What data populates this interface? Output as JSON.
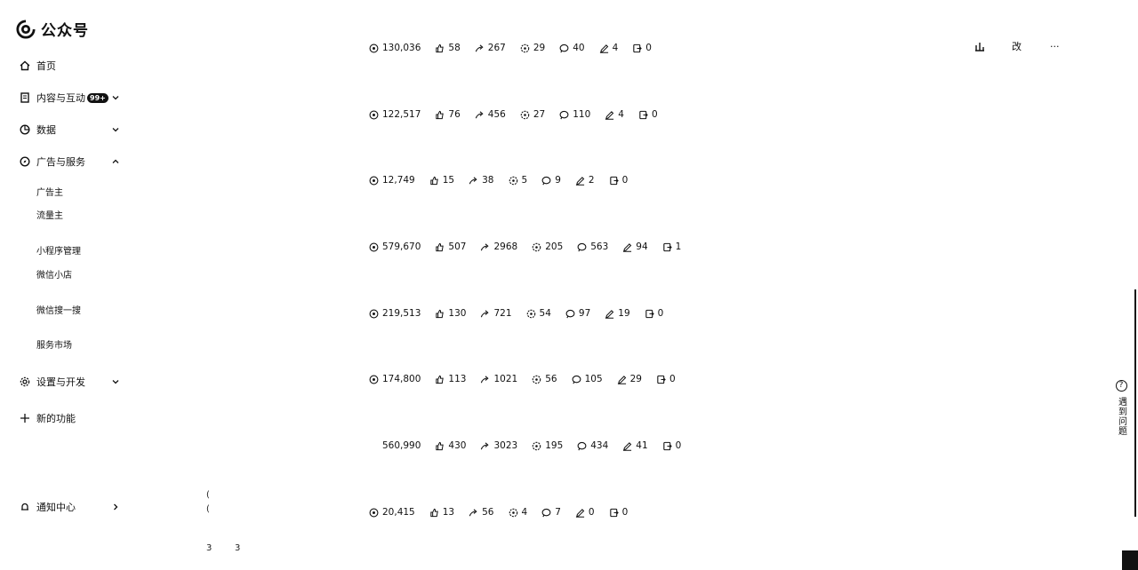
{
  "app": {
    "name": "公众号"
  },
  "sidebar": {
    "home": "首页",
    "content": "内容与互动",
    "content_badge": "99+",
    "data": "数据",
    "ads": "广告与服务",
    "ads_sub": [
      "广告主",
      "流量主",
      "小程序管理",
      "微信小店",
      "微信搜一搜",
      "服务市场"
    ],
    "settings": "设置与开发",
    "new_features": "新的功能",
    "notify": "通知中心"
  },
  "stray_text": {
    "a": "(",
    "b": "(",
    "c": "3",
    "d": "3"
  },
  "rows": [
    {
      "reads": "130,036",
      "likes": "58",
      "shares": "267",
      "wow": "29",
      "comments": "40",
      "edits": "4",
      "saves": "0"
    },
    {
      "reads": "122,517",
      "likes": "76",
      "shares": "456",
      "wow": "27",
      "comments": "110",
      "edits": "4",
      "saves": "0"
    },
    {
      "reads": "12,749",
      "likes": "15",
      "shares": "38",
      "wow": "5",
      "comments": "9",
      "edits": "2",
      "saves": "0"
    },
    {
      "reads": "579,670",
      "likes": "507",
      "shares": "2968",
      "wow": "205",
      "comments": "563",
      "edits": "94",
      "saves": "1"
    },
    {
      "reads": "219,513",
      "likes": "130",
      "shares": "721",
      "wow": "54",
      "comments": "97",
      "edits": "19",
      "saves": "0"
    },
    {
      "reads": "174,800",
      "likes": "113",
      "shares": "1021",
      "wow": "56",
      "comments": "105",
      "edits": "29",
      "saves": "0"
    },
    {
      "reads": "560,990",
      "likes": "430",
      "shares": "3023",
      "wow": "195",
      "comments": "434",
      "edits": "41",
      "saves": "0"
    },
    {
      "reads": "20,415",
      "likes": "13",
      "shares": "56",
      "wow": "4",
      "comments": "7",
      "edits": "0",
      "saves": "0"
    }
  ],
  "top_actions": {
    "stats_icon": "bar-chart-icon",
    "edit": "改",
    "more": "···"
  },
  "help": {
    "icon": "?",
    "label": "遇到问题"
  }
}
